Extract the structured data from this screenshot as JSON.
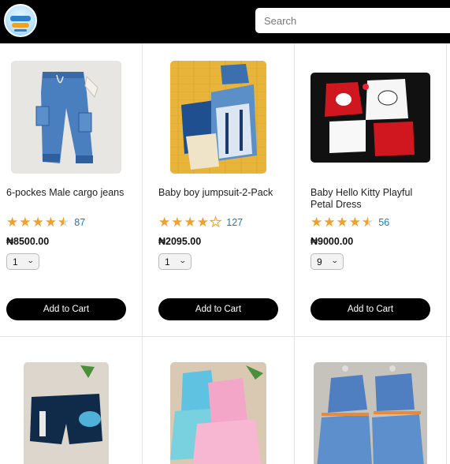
{
  "header": {
    "logo_alt": "store-logo",
    "search_placeholder": "Search"
  },
  "products": [
    {
      "title": "6-pockes Male cargo jeans",
      "rating_value": 4.5,
      "rating_count": "87",
      "price": "₦8500.00",
      "qty": "1",
      "cart_label": "Add to Cart"
    },
    {
      "title": "Baby boy jumpsuit-2-Pack",
      "rating_value": 4.0,
      "rating_count": "127",
      "price": "₦2095.00",
      "qty": "1",
      "cart_label": "Add to Cart"
    },
    {
      "title": "Baby Hello Kitty Playful Petal Dress",
      "rating_value": 4.5,
      "rating_count": "56",
      "price": "₦9000.00",
      "qty": "9",
      "cart_label": "Add to Cart"
    },
    {
      "title": "",
      "rating_value": null,
      "rating_count": "",
      "price": "",
      "qty": "",
      "cart_label": ""
    },
    {
      "title": "",
      "rating_value": null,
      "rating_count": "",
      "price": "",
      "qty": "",
      "cart_label": ""
    },
    {
      "title": "",
      "rating_value": null,
      "rating_count": "",
      "price": "",
      "qty": "",
      "cart_label": ""
    }
  ],
  "colors": {
    "topbar": "#000000",
    "star": "#f0a030",
    "count": "#1f77b4",
    "button": "#000000"
  }
}
